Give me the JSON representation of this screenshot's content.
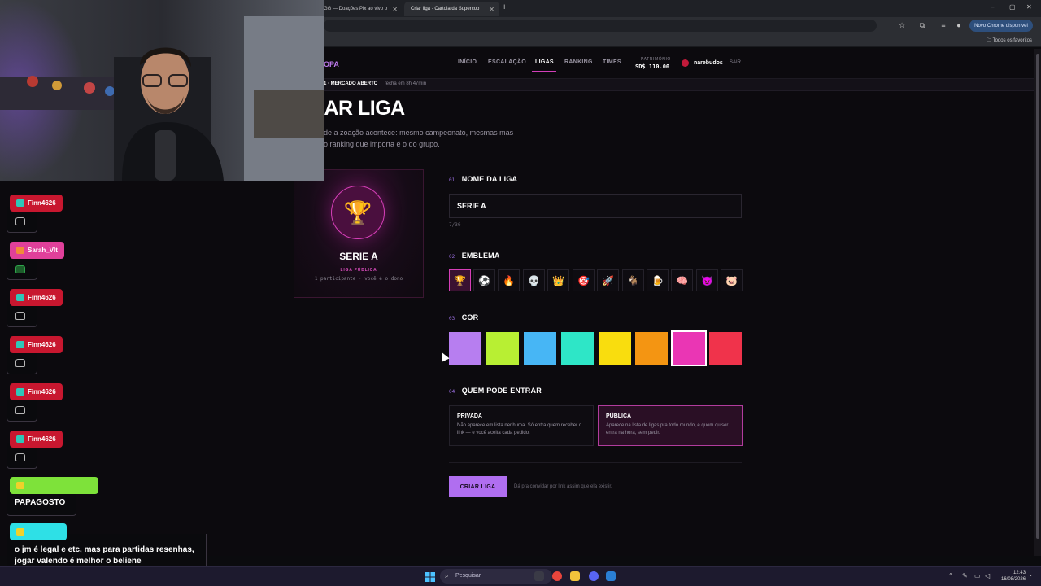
{
  "browser": {
    "tabs": [
      {
        "label": "GG — Doações Pix ao vivo p",
        "active": false
      },
      {
        "label": "Criar liga · Cartola da Supercop",
        "active": true
      }
    ],
    "new_tab": "+",
    "update_button": "Novo Chrome disponível",
    "bookmarks_folder": "Todos os favoritos",
    "window_controls": [
      "–",
      "▢",
      "✕"
    ]
  },
  "site": {
    "logo": "OPA",
    "nav": [
      "INÍCIO",
      "ESCALAÇÃO",
      "LIGAS",
      "RANKING",
      "TIMES"
    ],
    "active_nav": "LIGAS",
    "patrimonio_label": "PATRIMÔNIO",
    "patrimonio_value": "SD$ 110.00",
    "username": "narebudos",
    "logout": "SAIR",
    "market_status": "1 · MERCADO ABERTO",
    "market_close": "fecha em 8h 47min"
  },
  "page": {
    "title": "IAR LIGA",
    "description": "de a zoação acontece: mesmo campeonato, mesmas mas o ranking que importa é o do grupo."
  },
  "preview": {
    "emblem": "🏆",
    "name": "SERIE A",
    "visibility": "LIGA PÚBLICA",
    "meta": "1 participante · você é o dono"
  },
  "form": {
    "name": {
      "num": "01",
      "label": "NOME DA LIGA",
      "value": "SERIE A",
      "counter": "7/30"
    },
    "emblem": {
      "num": "02",
      "label": "EMBLEMA",
      "options": [
        "🏆",
        "⚽",
        "🔥",
        "💀",
        "👑",
        "🎯",
        "🚀",
        "🐐",
        "🍺",
        "🧠",
        "😈",
        "🐷"
      ],
      "selected": 0
    },
    "color": {
      "num": "03",
      "label": "COR",
      "options": [
        "#b77ef0",
        "#b8ef33",
        "#47b6f5",
        "#2ee6c7",
        "#f9dd0e",
        "#f49512",
        "#ea36b4",
        "#f0334b"
      ],
      "selected": 6
    },
    "access": {
      "num": "04",
      "label": "QUEM PODE ENTRAR",
      "options": [
        {
          "title": "PRIVADA",
          "desc": "Não aparece em lista nenhuma. Só entra quem receber o link — e você aceita cada pedido."
        },
        {
          "title": "PÚBLICA",
          "desc": "Aparece na lista de ligas pra todo mundo, e quem quiser entra na hora, sem pedir."
        }
      ],
      "selected": 1
    },
    "submit": "CRIAR LIGA",
    "hint": "Dá pra convidar por link assim que ela existir."
  },
  "chat": {
    "messages": [
      {
        "user": "Finn4626"
      },
      {
        "user": "Sarah_Vlt"
      },
      {
        "user": "Finn4626"
      },
      {
        "user": "Finn4626"
      },
      {
        "user": "Finn4626"
      },
      {
        "user": "Finn4626"
      },
      {
        "user": "",
        "text": "PAPAGOSTO"
      },
      {
        "user": "",
        "text": "o jm é legal e etc, mas para partidas resenhas, jogar valendo é melhor o beliene"
      }
    ]
  },
  "taskbar": {
    "search": "Pesquisar",
    "time": "12:43",
    "date": "16/08/2026"
  }
}
